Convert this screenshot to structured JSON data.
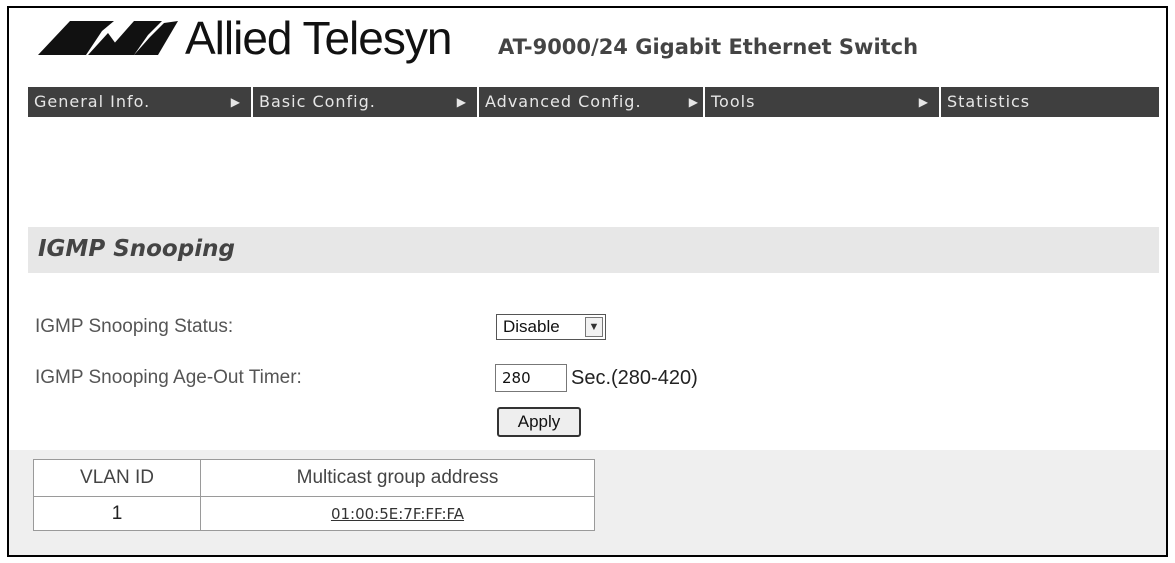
{
  "header": {
    "brand": "Allied Telesyn",
    "model": "AT-9000/24 Gigabit Ethernet Switch"
  },
  "menu": [
    {
      "label": "General Info.",
      "arrow": "▶"
    },
    {
      "label": "Basic Config.",
      "arrow": "▶"
    },
    {
      "label": "Advanced Config.",
      "arrow": "▶"
    },
    {
      "label": "Tools",
      "arrow": "▶"
    },
    {
      "label": "Statistics",
      "arrow": ""
    }
  ],
  "section": {
    "title": "IGMP Snooping"
  },
  "form": {
    "status_label": "IGMP Snooping Status:",
    "status_value": "Disable",
    "timer_label": "IGMP Snooping Age-Out Timer:",
    "timer_value": "280",
    "timer_unit": "Sec.(280-420)",
    "apply_label": "Apply"
  },
  "table": {
    "headers": [
      "VLAN ID",
      "Multicast group address"
    ],
    "rows": [
      [
        "1",
        "01:00:5E:7F:FF:FA"
      ]
    ]
  },
  "colors": {
    "menubar": "#3f3f3f",
    "section_band": "#e7e7e7",
    "lower_band": "#efefef"
  }
}
